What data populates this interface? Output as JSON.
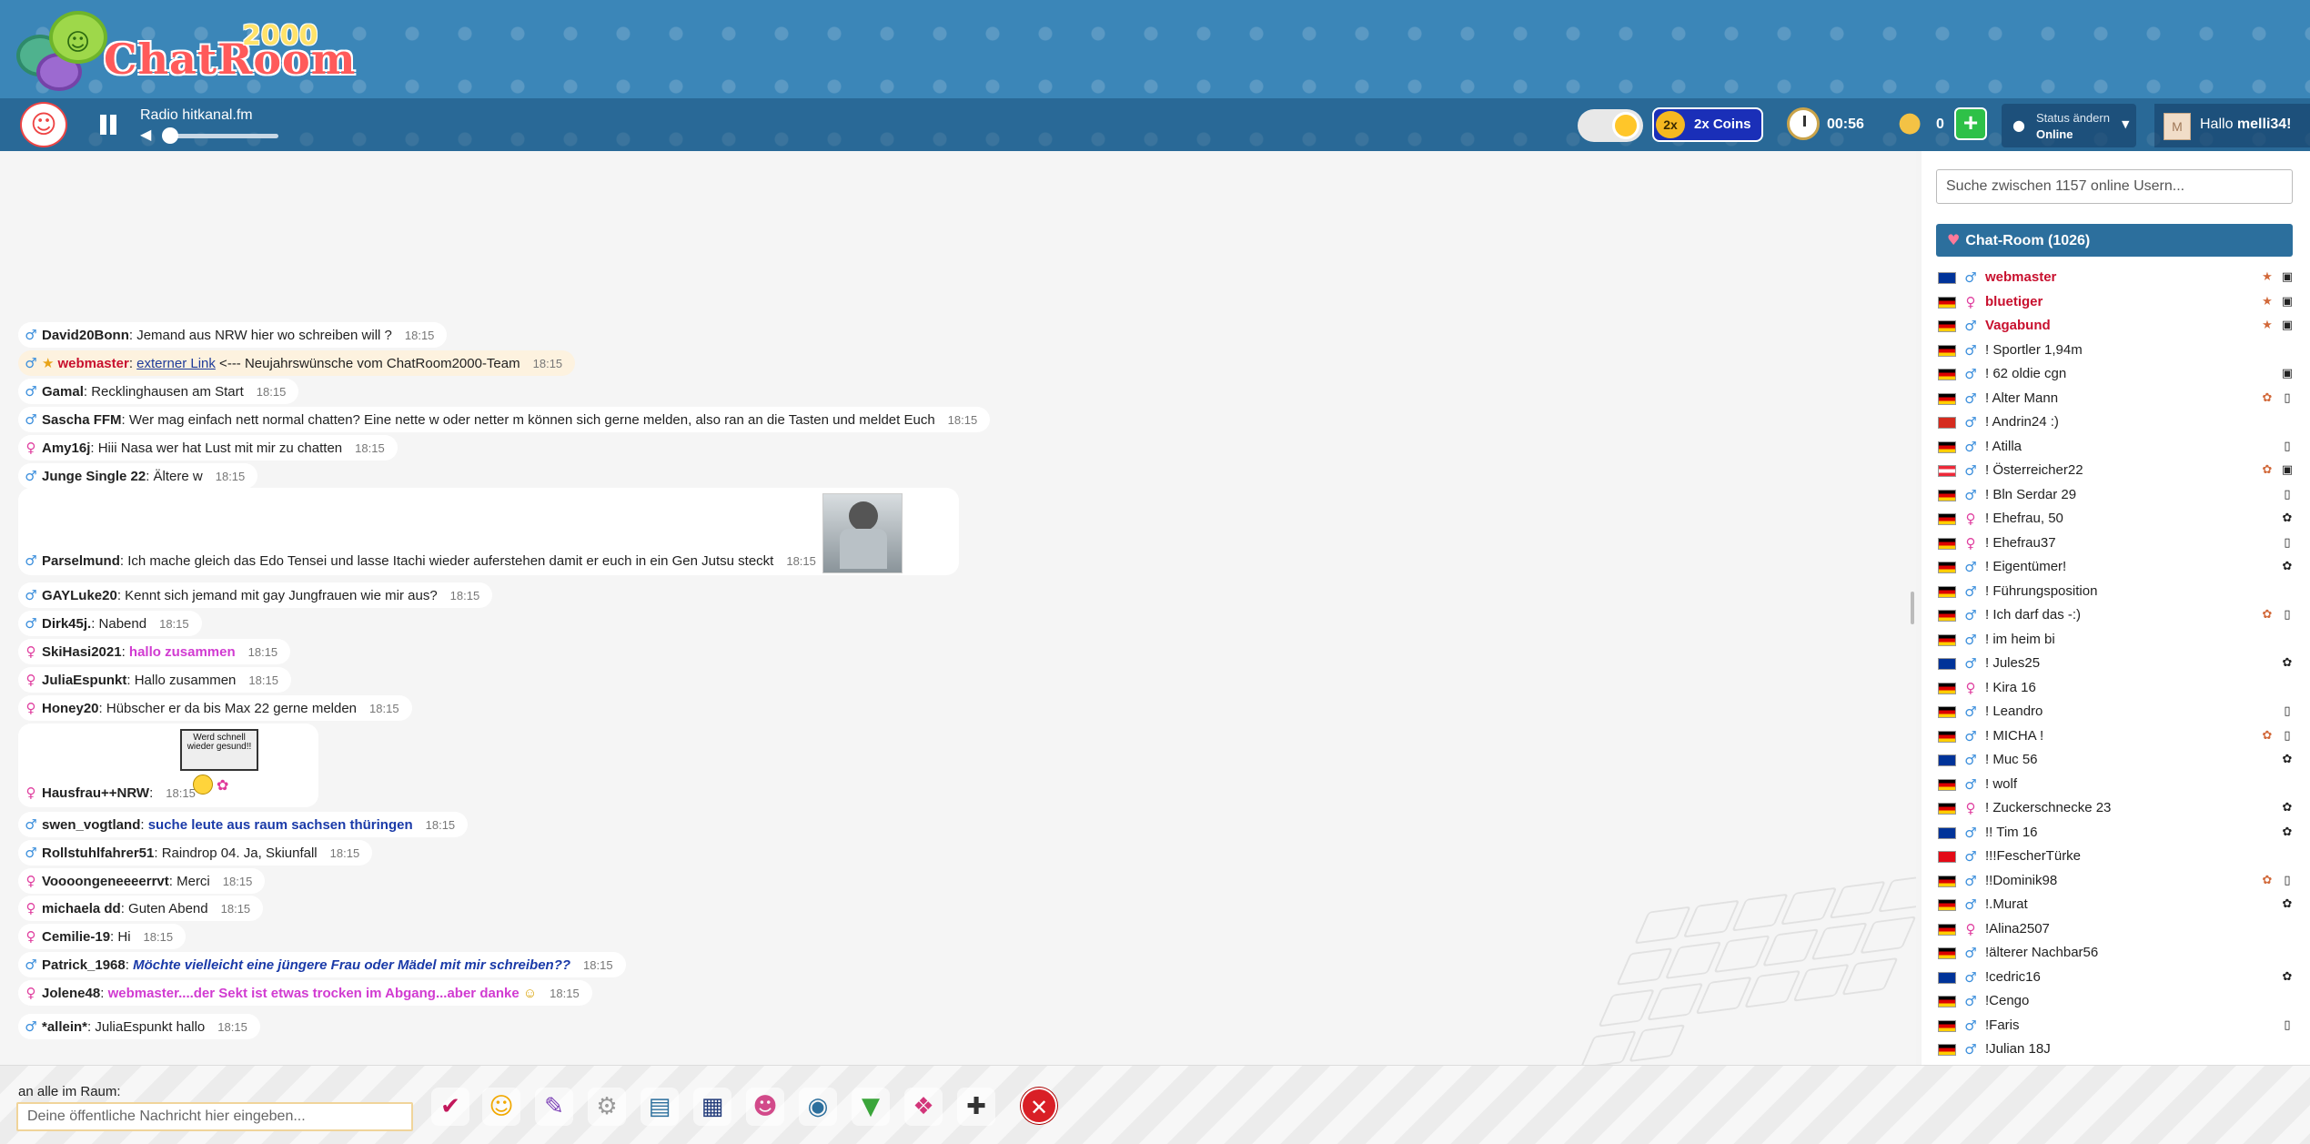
{
  "header": {
    "logo_text": "ChatRoom",
    "logo_year": "2000",
    "radio_station": "Radio hitkanal.fm",
    "volume_level": 0.05,
    "coins_label": "2x Coins",
    "coins_multiplier": "2x",
    "timer": "00:56",
    "coin_count": "0",
    "status_label": "Status ändern",
    "status_value": "Online",
    "greeting": "Hallo",
    "username": "melli34!",
    "user_avatar_letter": "M"
  },
  "chat": {
    "messages": [
      {
        "gender": "m",
        "user": "David20Bonn",
        "text": ": Jemand aus NRW hier wo schreiben will ?",
        "time": "18:15"
      },
      {
        "gender": "m",
        "user": "webmaster",
        "link": "externer Link",
        "text": " <--- Neujahrswünsche vom ChatRoom2000-Team",
        "time": "18:15"
      },
      {
        "gender": "m",
        "user": "Gamal",
        "text": ": Recklinghausen am Start",
        "time": "18:15"
      },
      {
        "gender": "m",
        "user": "Sascha FFM",
        "text": ": Wer mag einfach nett normal chatten? Eine nette w oder netter m können sich gerne melden, also ran an die Tasten und meldet Euch",
        "time": "18:15"
      },
      {
        "gender": "f",
        "user": "Amy16j",
        "text": ": Hiii Nasa wer hat Lust mit mir zu chatten",
        "time": "18:15"
      },
      {
        "gender": "m",
        "user": "Junge Single 22",
        "text": ": Ältere w",
        "time": "18:15"
      },
      {
        "gender": "m",
        "user": "Parselmund",
        "text": ": Ich mache gleich das Edo Tensei und lasse Itachi wieder auferstehen damit er euch in ein Gen Jutsu steckt",
        "time": "18:15"
      },
      {
        "gender": "m",
        "user": "GAYLuke20",
        "text": ": Kennt sich jemand mit gay Jungfrauen wie mir aus?",
        "time": "18:15"
      },
      {
        "gender": "m",
        "user": "Dirk45j.",
        "text": ": Nabend",
        "time": "18:15"
      },
      {
        "gender": "f",
        "user": "SkiHasi2021",
        "text": "hallo zusammen",
        "time": "18:15"
      },
      {
        "gender": "f",
        "user": "JuliaEspunkt",
        "text": ": Hallo zusammen",
        "time": "18:15"
      },
      {
        "gender": "f",
        "user": "Honey20",
        "text": ": Hübscher er da bis Max 22 gerne melden",
        "time": "18:15"
      },
      {
        "gender": "f",
        "user": "Hausfrau++NRW",
        "text": ":",
        "image_text": "Werd schnell wieder gesund!!",
        "time": "18:15"
      },
      {
        "gender": "m",
        "user": "swen_vogtland",
        "text": "suche leute aus raum sachsen thüringen",
        "time": "18:15"
      },
      {
        "gender": "m",
        "user": "Rollstuhlfahrer51",
        "text": ": Raindrop 04. Ja, Skiunfall",
        "time": "18:15"
      },
      {
        "gender": "f",
        "user": "Voooongeneeeerrvt",
        "text": ": Merci",
        "time": "18:15"
      },
      {
        "gender": "f",
        "user": "michaela dd",
        "text": ": Guten Abend",
        "time": "18:15"
      },
      {
        "gender": "f",
        "user": "Cemilie-19",
        "text": ": Hi",
        "time": "18:15"
      },
      {
        "gender": "m",
        "user": "Patrick_1968",
        "text": "Möchte vielleicht eine jüngere Frau oder Mädel mit mir schreiben??",
        "time": "18:15"
      },
      {
        "gender": "f",
        "user": "Jolene48",
        "text": "webmaster....der Sekt ist etwas trocken im Abgang...aber danke",
        "time": "18:15"
      },
      {
        "gender": "m",
        "user": "*allein*",
        "text": ": JuliaEspunkt hallo",
        "time": "18:15"
      }
    ]
  },
  "sidebar": {
    "search_placeholder": "Suche zwischen 1157 online Usern...",
    "room_title": "Chat-Room (1026)",
    "users": [
      {
        "flag": "eu",
        "gender": "m",
        "name": "webmaster",
        "staff": true
      },
      {
        "flag": "de",
        "gender": "f",
        "name": "bluetiger",
        "staff": true
      },
      {
        "flag": "de",
        "gender": "m",
        "name": "Vagabund",
        "staff": true
      },
      {
        "flag": "de",
        "gender": "m",
        "name": "! Sportler 1,94m"
      },
      {
        "flag": "de",
        "gender": "m",
        "name": "! 62 oldie cgn"
      },
      {
        "flag": "de",
        "gender": "m",
        "name": "! Alter Mann"
      },
      {
        "flag": "ch",
        "gender": "m",
        "name": "! Andrin24 :)"
      },
      {
        "flag": "de",
        "gender": "m",
        "name": "! Atilla"
      },
      {
        "flag": "at",
        "gender": "m",
        "name": "! Österreicher22"
      },
      {
        "flag": "de",
        "gender": "m",
        "name": "! Bln Serdar 29"
      },
      {
        "flag": "de",
        "gender": "f",
        "name": "! Ehefrau, 50"
      },
      {
        "flag": "de",
        "gender": "f",
        "name": "! Ehefrau37"
      },
      {
        "flag": "de",
        "gender": "m",
        "name": "! Eigentümer!"
      },
      {
        "flag": "de",
        "gender": "m",
        "name": "! Führungsposition"
      },
      {
        "flag": "de",
        "gender": "m",
        "name": "! Ich darf das -:)"
      },
      {
        "flag": "de",
        "gender": "m",
        "name": "! im heim bi"
      },
      {
        "flag": "eu",
        "gender": "m",
        "name": "! Jules25"
      },
      {
        "flag": "de",
        "gender": "f",
        "name": "! Kira 16"
      },
      {
        "flag": "de",
        "gender": "m",
        "name": "! Leandro"
      },
      {
        "flag": "de",
        "gender": "m",
        "name": "! MICHA !"
      },
      {
        "flag": "eu",
        "gender": "m",
        "name": "! Muc 56"
      },
      {
        "flag": "de",
        "gender": "m",
        "name": "! wolf"
      },
      {
        "flag": "de",
        "gender": "f",
        "name": "! Zuckerschnecke 23"
      },
      {
        "flag": "eu",
        "gender": "m",
        "name": "!! Tim 16"
      },
      {
        "flag": "tr",
        "gender": "m",
        "name": "!!!FescherTürke"
      },
      {
        "flag": "de",
        "gender": "m",
        "name": "!!Dominik98"
      },
      {
        "flag": "de",
        "gender": "m",
        "name": "!.Murat"
      },
      {
        "flag": "de",
        "gender": "f",
        "name": "!Alina2507"
      },
      {
        "flag": "de",
        "gender": "m",
        "name": "!älterer Nachbar56"
      },
      {
        "flag": "eu",
        "gender": "m",
        "name": "!cedric16"
      },
      {
        "flag": "de",
        "gender": "m",
        "name": "!Cengo"
      },
      {
        "flag": "de",
        "gender": "m",
        "name": "!Faris"
      },
      {
        "flag": "de",
        "gender": "m",
        "name": "!Julian 18J"
      }
    ]
  },
  "input": {
    "label": "an alle im Raum:",
    "placeholder": "Deine öffentliche Nachricht hier eingeben..."
  },
  "toolbar": {
    "icons": [
      "checkmark-icon",
      "smiley-icon",
      "palette-icon",
      "settings-gear-icon",
      "profile-card-icon",
      "film-icon",
      "friends-icon",
      "camera-icon",
      "shop-basket-icon",
      "gift-icon",
      "game-controller-icon",
      "close-icon"
    ]
  }
}
